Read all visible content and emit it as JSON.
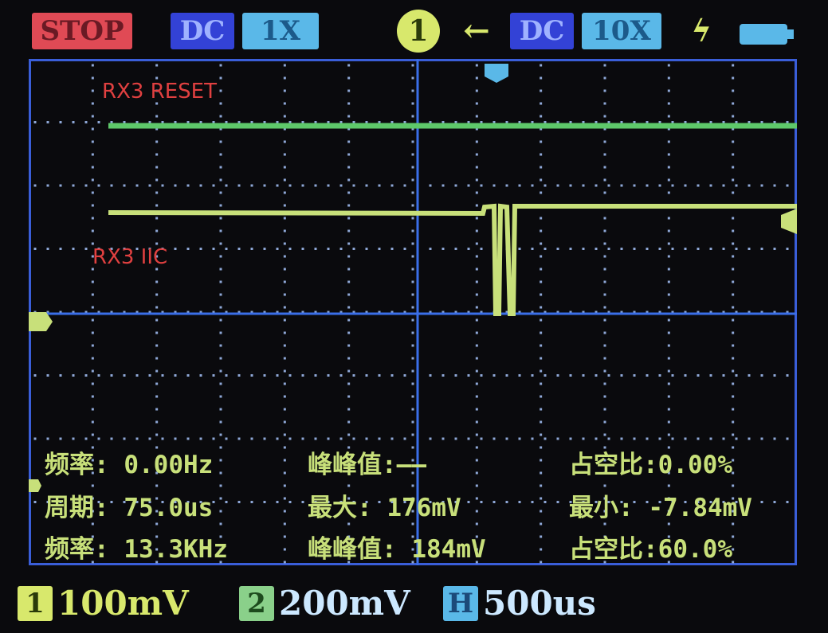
{
  "topbar": {
    "run_state": "STOP",
    "ch2_coupling": "DC",
    "ch2_probe": "1X",
    "trigger_channel": "1",
    "trigger_arrow": "←",
    "ch1_coupling": "DC",
    "ch1_probe": "10X",
    "trigger_edge": "ϟ"
  },
  "trace_labels": {
    "reset": "RX3 RESET",
    "iic": "RX3 IIC"
  },
  "measurements": {
    "row1": {
      "freq": "频率: 0.00Hz",
      "vpp": "峰峰值:——",
      "duty": "占空比:0.00%"
    },
    "row2": {
      "period": "周期: 75.0us",
      "max": "最大: 176mV",
      "min": "最小: -7.84mV"
    },
    "row3": {
      "freq": "频率: 13.3KHz",
      "vpp": "峰峰值: 184mV",
      "duty": "占空比:60.0%"
    }
  },
  "bottombar": {
    "ch1_label": "1",
    "ch1_scale": "100mV",
    "ch2_label": "2",
    "ch2_scale": "200mV",
    "h_label": "H",
    "h_scale": "500us"
  },
  "colors": {
    "grid": "#8fa8d8",
    "center_axis": "#3a6ee8",
    "trace_reset": "#5ec86a",
    "trace_iic": "#c8e07a",
    "label_red": "#e04040"
  }
}
